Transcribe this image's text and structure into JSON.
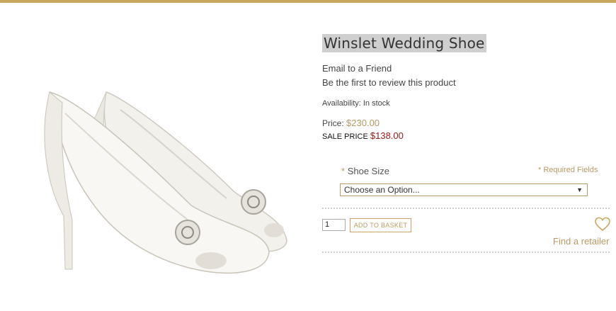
{
  "colors": {
    "accent": "#c9a65f",
    "sale": "#9b1b1b",
    "gold_text": "#b89a64"
  },
  "product": {
    "title": "Winslet Wedding Shoe",
    "email_link": "Email to a Friend",
    "review_link": "Be the first to review this product",
    "availability": "Availability: In stock",
    "price_label": "Price:",
    "price_value": "$230.00",
    "sale_label": "SALE PRICE",
    "sale_value": "$138.00"
  },
  "options": {
    "asterisk": "*",
    "size_label": "Shoe Size",
    "required_note": "* Required Fields",
    "select_value": "Choose an Option...",
    "select_arrow": "▼"
  },
  "cart": {
    "quantity": "1",
    "add_label": "ADD TO BASKET",
    "heart_icon": "heart-outline-icon",
    "find_retailer": "Find a retailer"
  }
}
